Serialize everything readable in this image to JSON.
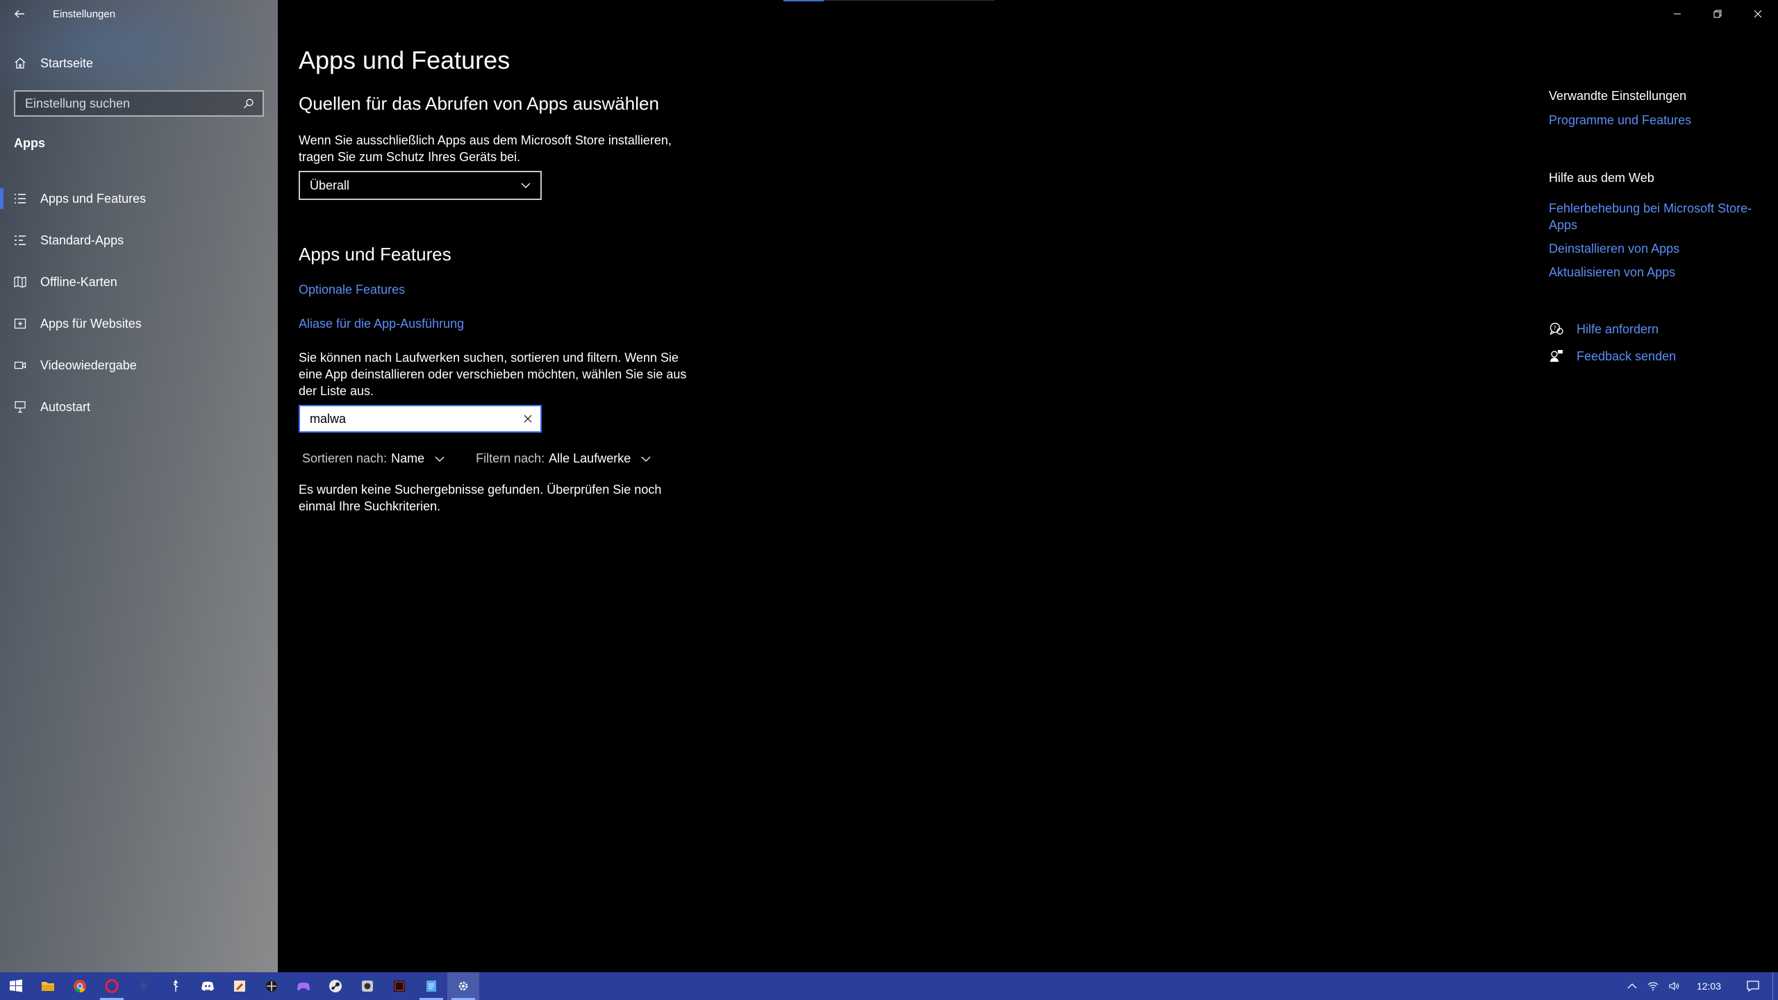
{
  "window": {
    "title": "Einstellungen"
  },
  "sidebar": {
    "home_label": "Startseite",
    "search_placeholder": "Einstellung suchen",
    "section_label": "Apps",
    "items": [
      {
        "label": "Apps und Features",
        "icon": "list-icon",
        "active": true
      },
      {
        "label": "Standard-Apps",
        "icon": "default-apps-icon"
      },
      {
        "label": "Offline-Karten",
        "icon": "map-icon"
      },
      {
        "label": "Apps für Websites",
        "icon": "web-apps-icon"
      },
      {
        "label": "Videowiedergabe",
        "icon": "video-icon"
      },
      {
        "label": "Autostart",
        "icon": "startup-icon"
      }
    ]
  },
  "main": {
    "page_title": "Apps und Features",
    "sources": {
      "heading": "Quellen für das Abrufen von Apps auswählen",
      "description": "Wenn Sie ausschließlich Apps aus dem Microsoft Store installieren, tragen Sie zum Schutz Ihres Geräts bei.",
      "dropdown_value": "Überall"
    },
    "apps_features": {
      "heading": "Apps und Features",
      "link_optional": "Optionale Features",
      "link_aliases": "Aliase für die App-Ausführung",
      "description": "Sie können nach Laufwerken suchen, sortieren und filtern. Wenn Sie eine App deinstallieren oder verschieben möchten, wählen Sie sie aus der Liste aus.",
      "search_value": "malwa",
      "sort_label": "Sortieren nach:",
      "sort_value": "Name",
      "filter_label": "Filtern nach:",
      "filter_value": "Alle Laufwerke",
      "no_results": "Es wurden keine Suchergebnisse gefunden. Überprüfen Sie noch einmal Ihre Suchkriterien."
    }
  },
  "right_panel": {
    "related_heading": "Verwandte Einstellungen",
    "related_link": "Programme und Features",
    "web_heading": "Hilfe aus dem Web",
    "web_links": [
      "Fehlerbehebung bei Microsoft Store-Apps",
      "Deinstallieren von Apps",
      "Aktualisieren von Apps"
    ],
    "help_link": "Hilfe anfordern",
    "feedback_link": "Feedback senden"
  },
  "taskbar": {
    "clock": "12:03",
    "icons": [
      "windows-start-icon",
      "file-explorer-icon",
      "chrome-icon",
      "opera-icon",
      "app-icon",
      "usb-icon",
      "discord-icon",
      "paint-icon",
      "hub-icon",
      "gamepad-icon",
      "steam-icon",
      "camera-app-icon",
      "dark-app-icon",
      "notepad-icon",
      "settings-icon"
    ]
  },
  "colors": {
    "accent": "#4a6fe0",
    "link": "#5b8df5",
    "taskbar": "#2a3f9a"
  }
}
